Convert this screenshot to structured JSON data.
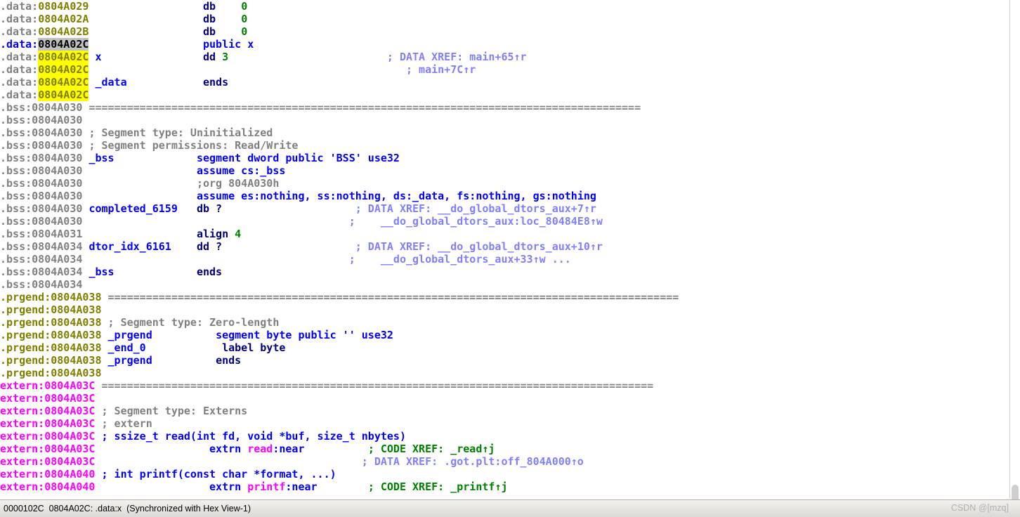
{
  "window": {
    "title": "IDA View-A disassembly"
  },
  "statusbar": {
    "text": "0000102C  0804A02C: .data:x  (Synchronized with Hex View-1)",
    "watermark": "CSDN @[mzq]"
  },
  "colors": {
    "segment_data": "#7f7f00",
    "segment_bss": "#808080",
    "segment_prgend": "#7f7f00",
    "segment_extern": "#ff00ff",
    "keyword": "#00007f",
    "directive": "#0000ff",
    "number": "#007f00",
    "comment": "#808080",
    "data_xref": "#7f7fff",
    "code_xref": "#008000",
    "highlight_selected": "#c0c0c0",
    "highlight_match": "#ffff00",
    "background": "#ffffff"
  },
  "separator": "=======================================================================================",
  "separator_long": "==========================================================================================",
  "lines": [
    {
      "seg": ".data:",
      "addr": "0804A029",
      "label": "",
      "text": "db    0"
    },
    {
      "seg": ".data:",
      "addr": "0804A02A",
      "label": "",
      "text": "db    0"
    },
    {
      "seg": ".data:",
      "addr": "0804A02B",
      "label": "",
      "text": "db    0"
    },
    {
      "seg": ".data:",
      "addr": "0804A02C",
      "label": "",
      "text": "public x"
    },
    {
      "seg": ".data:",
      "addr": "0804A02C",
      "label": "x",
      "text": "dd 3",
      "comment": "; DATA XREF: main+65↑r"
    },
    {
      "seg": ".data:",
      "addr": "0804A02C",
      "label": "",
      "text": "",
      "comment": "; main+7C↑r"
    },
    {
      "seg": ".data:",
      "addr": "0804A02C",
      "label": "_data",
      "text": "ends"
    },
    {
      "seg": ".data:",
      "addr": "0804A02C",
      "label": "",
      "text": ""
    },
    {
      "seg": ".bss:",
      "addr": "0804A030",
      "label": "",
      "text": "separator"
    },
    {
      "seg": ".bss:",
      "addr": "0804A030",
      "label": "",
      "text": ""
    },
    {
      "seg": ".bss:",
      "addr": "0804A030",
      "label": "",
      "text": "; Segment type: Uninitialized"
    },
    {
      "seg": ".bss:",
      "addr": "0804A030",
      "label": "",
      "text": "; Segment permissions: Read/Write"
    },
    {
      "seg": ".bss:",
      "addr": "0804A030",
      "label": "_bss",
      "text": "segment dword public 'BSS' use32"
    },
    {
      "seg": ".bss:",
      "addr": "0804A030",
      "label": "",
      "text": "assume cs:_bss"
    },
    {
      "seg": ".bss:",
      "addr": "0804A030",
      "label": "",
      "text": ";org 804A030h"
    },
    {
      "seg": ".bss:",
      "addr": "0804A030",
      "label": "",
      "text": "assume es:nothing, ss:nothing, ds:_data, fs:nothing, gs:nothing"
    },
    {
      "seg": ".bss:",
      "addr": "0804A030",
      "label": "completed_6159",
      "text": "db ?",
      "comment": "; DATA XREF: __do_global_dtors_aux+7↑r"
    },
    {
      "seg": ".bss:",
      "addr": "0804A030",
      "label": "",
      "text": "",
      "comment": "; __do_global_dtors_aux:loc_80484E8↑w"
    },
    {
      "seg": ".bss:",
      "addr": "0804A031",
      "label": "",
      "text": "align 4"
    },
    {
      "seg": ".bss:",
      "addr": "0804A034",
      "label": "dtor_idx_6161",
      "text": "dd ?",
      "comment": "; DATA XREF: __do_global_dtors_aux+10↑r"
    },
    {
      "seg": ".bss:",
      "addr": "0804A034",
      "label": "",
      "text": "",
      "comment": "; __do_global_dtors_aux+33↑w ..."
    },
    {
      "seg": ".bss:",
      "addr": "0804A034",
      "label": "_bss",
      "text": "ends"
    },
    {
      "seg": ".bss:",
      "addr": "0804A034",
      "label": "",
      "text": ""
    },
    {
      "seg": ".prgend:",
      "addr": "0804A038",
      "label": "",
      "text": "separator"
    },
    {
      "seg": ".prgend:",
      "addr": "0804A038",
      "label": "",
      "text": ""
    },
    {
      "seg": ".prgend:",
      "addr": "0804A038",
      "label": "",
      "text": "; Segment type: Zero-length"
    },
    {
      "seg": ".prgend:",
      "addr": "0804A038",
      "label": "_prgend",
      "text": "segment byte public '' use32"
    },
    {
      "seg": ".prgend:",
      "addr": "0804A038",
      "label": "_end_0",
      "text": "label byte"
    },
    {
      "seg": ".prgend:",
      "addr": "0804A038",
      "label": "_prgend",
      "text": "ends"
    },
    {
      "seg": ".prgend:",
      "addr": "0804A038",
      "label": "",
      "text": ""
    },
    {
      "seg": "extern:",
      "addr": "0804A03C",
      "label": "",
      "text": "separator"
    },
    {
      "seg": "extern:",
      "addr": "0804A03C",
      "label": "",
      "text": ""
    },
    {
      "seg": "extern:",
      "addr": "0804A03C",
      "label": "",
      "text": "; Segment type: Externs"
    },
    {
      "seg": "extern:",
      "addr": "0804A03C",
      "label": "",
      "text": "; extern"
    },
    {
      "seg": "extern:",
      "addr": "0804A03C",
      "label": "",
      "text": "; ssize_t read(int fd, void *buf, size_t nbytes)"
    },
    {
      "seg": "extern:",
      "addr": "0804A03C",
      "label": "",
      "text": "extrn read:near",
      "comment": "; CODE XREF: _read↑j"
    },
    {
      "seg": "extern:",
      "addr": "0804A03C",
      "label": "",
      "text": "",
      "comment": "; DATA XREF: .got.plt:off_804A000↑o"
    },
    {
      "seg": "extern:",
      "addr": "0804A040",
      "label": "",
      "text": "; int printf(const char *format, ...)"
    },
    {
      "seg": "extern:",
      "addr": "0804A040",
      "label": "",
      "text": "extrn printf:near",
      "comment": "; CODE XREF: _printf↑j"
    }
  ],
  "rows": {
    "r0": {
      "seg": ".data:",
      "addr": "0804A029",
      "kw": "db",
      "num": "0"
    },
    "r1": {
      "seg": ".data:",
      "addr": "0804A02A",
      "kw": "db",
      "num": "0"
    },
    "r2": {
      "seg": ".data:",
      "addr": "0804A02B",
      "kw": "db",
      "num": "0"
    },
    "r3": {
      "seg": ".data:",
      "addr": "0804A02C",
      "dir": "public x"
    },
    "r4": {
      "seg": ".data:",
      "addr": "0804A02C",
      "label": "x",
      "kw": "dd",
      "num": "3",
      "xref": "; DATA XREF: main+65↑r"
    },
    "r5": {
      "seg": ".data:",
      "addr": "0804A02C",
      "xref": "; main+7C↑r"
    },
    "r6": {
      "seg": ".data:",
      "addr": "0804A02C",
      "label": "_data",
      "kw": "ends"
    },
    "r7": {
      "seg": ".data:",
      "addr": "0804A02C"
    },
    "r8": {
      "seg": ".bss:",
      "addr": "0804A030"
    },
    "r9": {
      "seg": ".bss:",
      "addr": "0804A030"
    },
    "r10": {
      "seg": ".bss:",
      "addr": "0804A030",
      "cmt": "; Segment type: Uninitialized"
    },
    "r11": {
      "seg": ".bss:",
      "addr": "0804A030",
      "cmt": "; Segment permissions: Read/Write"
    },
    "r12": {
      "seg": ".bss:",
      "addr": "0804A030",
      "label": "_bss",
      "dir": "segment dword public 'BSS' use32"
    },
    "r13": {
      "seg": ".bss:",
      "addr": "0804A030",
      "dir": "assume cs:_bss"
    },
    "r14": {
      "seg": ".bss:",
      "addr": "0804A030",
      "cmt": ";org 804A030h"
    },
    "r15": {
      "seg": ".bss:",
      "addr": "0804A030",
      "dir": "assume es:nothing, ss:nothing, ds:_data, fs:nothing, gs:nothing"
    },
    "r16": {
      "seg": ".bss:",
      "addr": "0804A030",
      "label": "completed_6159",
      "kw": "db ?",
      "xref": "; DATA XREF: __do_global_dtors_aux+7↑r"
    },
    "r17": {
      "seg": ".bss:",
      "addr": "0804A030",
      "xref": ";    __do_global_dtors_aux:loc_80484E8↑w"
    },
    "r18": {
      "seg": ".bss:",
      "addr": "0804A031",
      "kw": "align",
      "num": "4"
    },
    "r19": {
      "seg": ".bss:",
      "addr": "0804A034",
      "label": "dtor_idx_6161",
      "kw": "dd ?",
      "xref": "; DATA XREF: __do_global_dtors_aux+10↑r"
    },
    "r20": {
      "seg": ".bss:",
      "addr": "0804A034",
      "xref": ";    __do_global_dtors_aux+33↑w ..."
    },
    "r21": {
      "seg": ".bss:",
      "addr": "0804A034",
      "label": "_bss",
      "kw": "ends"
    },
    "r22": {
      "seg": ".bss:",
      "addr": "0804A034"
    },
    "r23": {
      "seg": ".prgend:",
      "addr": "0804A038"
    },
    "r24": {
      "seg": ".prgend:",
      "addr": "0804A038"
    },
    "r25": {
      "seg": ".prgend:",
      "addr": "0804A038",
      "cmt": "; Segment type: Zero-length"
    },
    "r26": {
      "seg": ".prgend:",
      "addr": "0804A038",
      "label": "_prgend",
      "dir": "segment byte public '' use32"
    },
    "r27": {
      "seg": ".prgend:",
      "addr": "0804A038",
      "label": "_end_0",
      "kw": "label byte"
    },
    "r28": {
      "seg": ".prgend:",
      "addr": "0804A038",
      "label": "_prgend",
      "kw": "ends"
    },
    "r29": {
      "seg": ".prgend:",
      "addr": "0804A038"
    },
    "r30": {
      "seg": "extern:",
      "addr": "0804A03C"
    },
    "r31": {
      "seg": "extern:",
      "addr": "0804A03C"
    },
    "r32": {
      "seg": "extern:",
      "addr": "0804A03C",
      "cmt": "; Segment type: Externs"
    },
    "r33": {
      "seg": "extern:",
      "addr": "0804A03C",
      "cmt": "; extern"
    },
    "r34": {
      "seg": "extern:",
      "addr": "0804A03C",
      "proto": "; ssize_t read(int fd, void *buf, size_t nbytes)"
    },
    "r35": {
      "seg": "extern:",
      "addr": "0804A03C",
      "extrn": "extrn",
      "fn": "read",
      "near": ":near",
      "xref": "; CODE XREF: _read↑j"
    },
    "r36": {
      "seg": "extern:",
      "addr": "0804A03C",
      "xref": "; DATA XREF: .got.plt:off_804A000↑o"
    },
    "r37": {
      "seg": "extern:",
      "addr": "0804A040",
      "proto": "; int printf(const char *format, ...)"
    },
    "r38": {
      "seg": "extern:",
      "addr": "0804A040",
      "extrn": "extrn",
      "fn": "printf",
      "near": ":near",
      "xref": "; CODE XREF: _printf↑j"
    }
  }
}
